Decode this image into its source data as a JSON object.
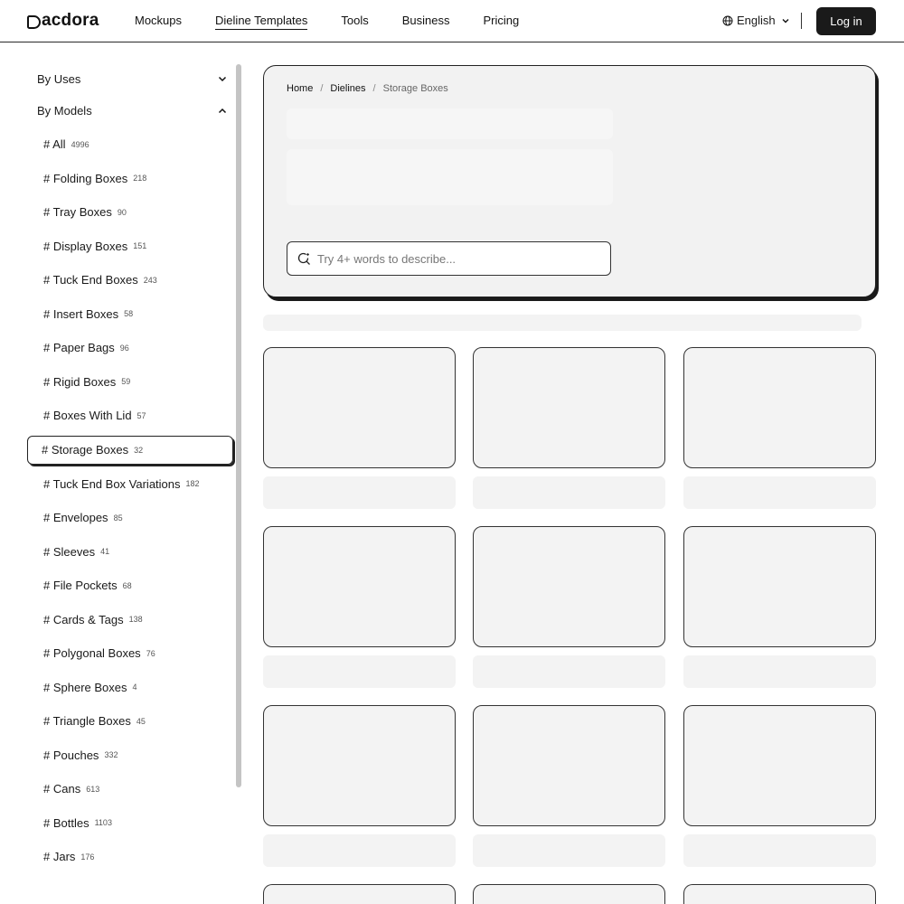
{
  "header": {
    "logo": "acdora",
    "nav": [
      "Mockups",
      "Dieline Templates",
      "Tools",
      "Business",
      "Pricing"
    ],
    "active_nav": "Dieline Templates",
    "language": "English",
    "login_label": "Log in"
  },
  "sidebar": {
    "groups": [
      {
        "label": "By Uses",
        "expanded": false
      },
      {
        "label": "By Models",
        "expanded": true
      }
    ],
    "items": [
      {
        "label": "# All",
        "count": "4996"
      },
      {
        "label": "# Folding Boxes",
        "count": "218"
      },
      {
        "label": "# Tray Boxes",
        "count": "90"
      },
      {
        "label": "# Display Boxes",
        "count": "151"
      },
      {
        "label": "# Tuck End Boxes",
        "count": "243"
      },
      {
        "label": "# Insert Boxes",
        "count": "58"
      },
      {
        "label": "# Paper Bags",
        "count": "96"
      },
      {
        "label": "# Rigid Boxes",
        "count": "59"
      },
      {
        "label": "# Boxes With Lid",
        "count": "57"
      },
      {
        "label": "# Storage Boxes",
        "count": "32"
      },
      {
        "label": "# Tuck End Box Variations",
        "count": "182"
      },
      {
        "label": "# Envelopes",
        "count": "85"
      },
      {
        "label": "# Sleeves",
        "count": "41"
      },
      {
        "label": "# File Pockets",
        "count": "68"
      },
      {
        "label": "# Cards & Tags",
        "count": "138"
      },
      {
        "label": "# Polygonal Boxes",
        "count": "76"
      },
      {
        "label": "# Sphere Boxes",
        "count": "4"
      },
      {
        "label": "# Triangle Boxes",
        "count": "45"
      },
      {
        "label": "# Pouches",
        "count": "332"
      },
      {
        "label": "# Cans",
        "count": "613"
      },
      {
        "label": "# Bottles",
        "count": "1103"
      },
      {
        "label": "# Jars",
        "count": "176"
      }
    ],
    "active_item": "# Storage Boxes"
  },
  "breadcrumb": [
    "Home",
    "Dielines",
    "Storage Boxes"
  ],
  "search": {
    "placeholder": "Try 4+ words to describe..."
  },
  "colors": {
    "accent": "#1a1a1a",
    "skeleton": "#f3f3f3"
  }
}
